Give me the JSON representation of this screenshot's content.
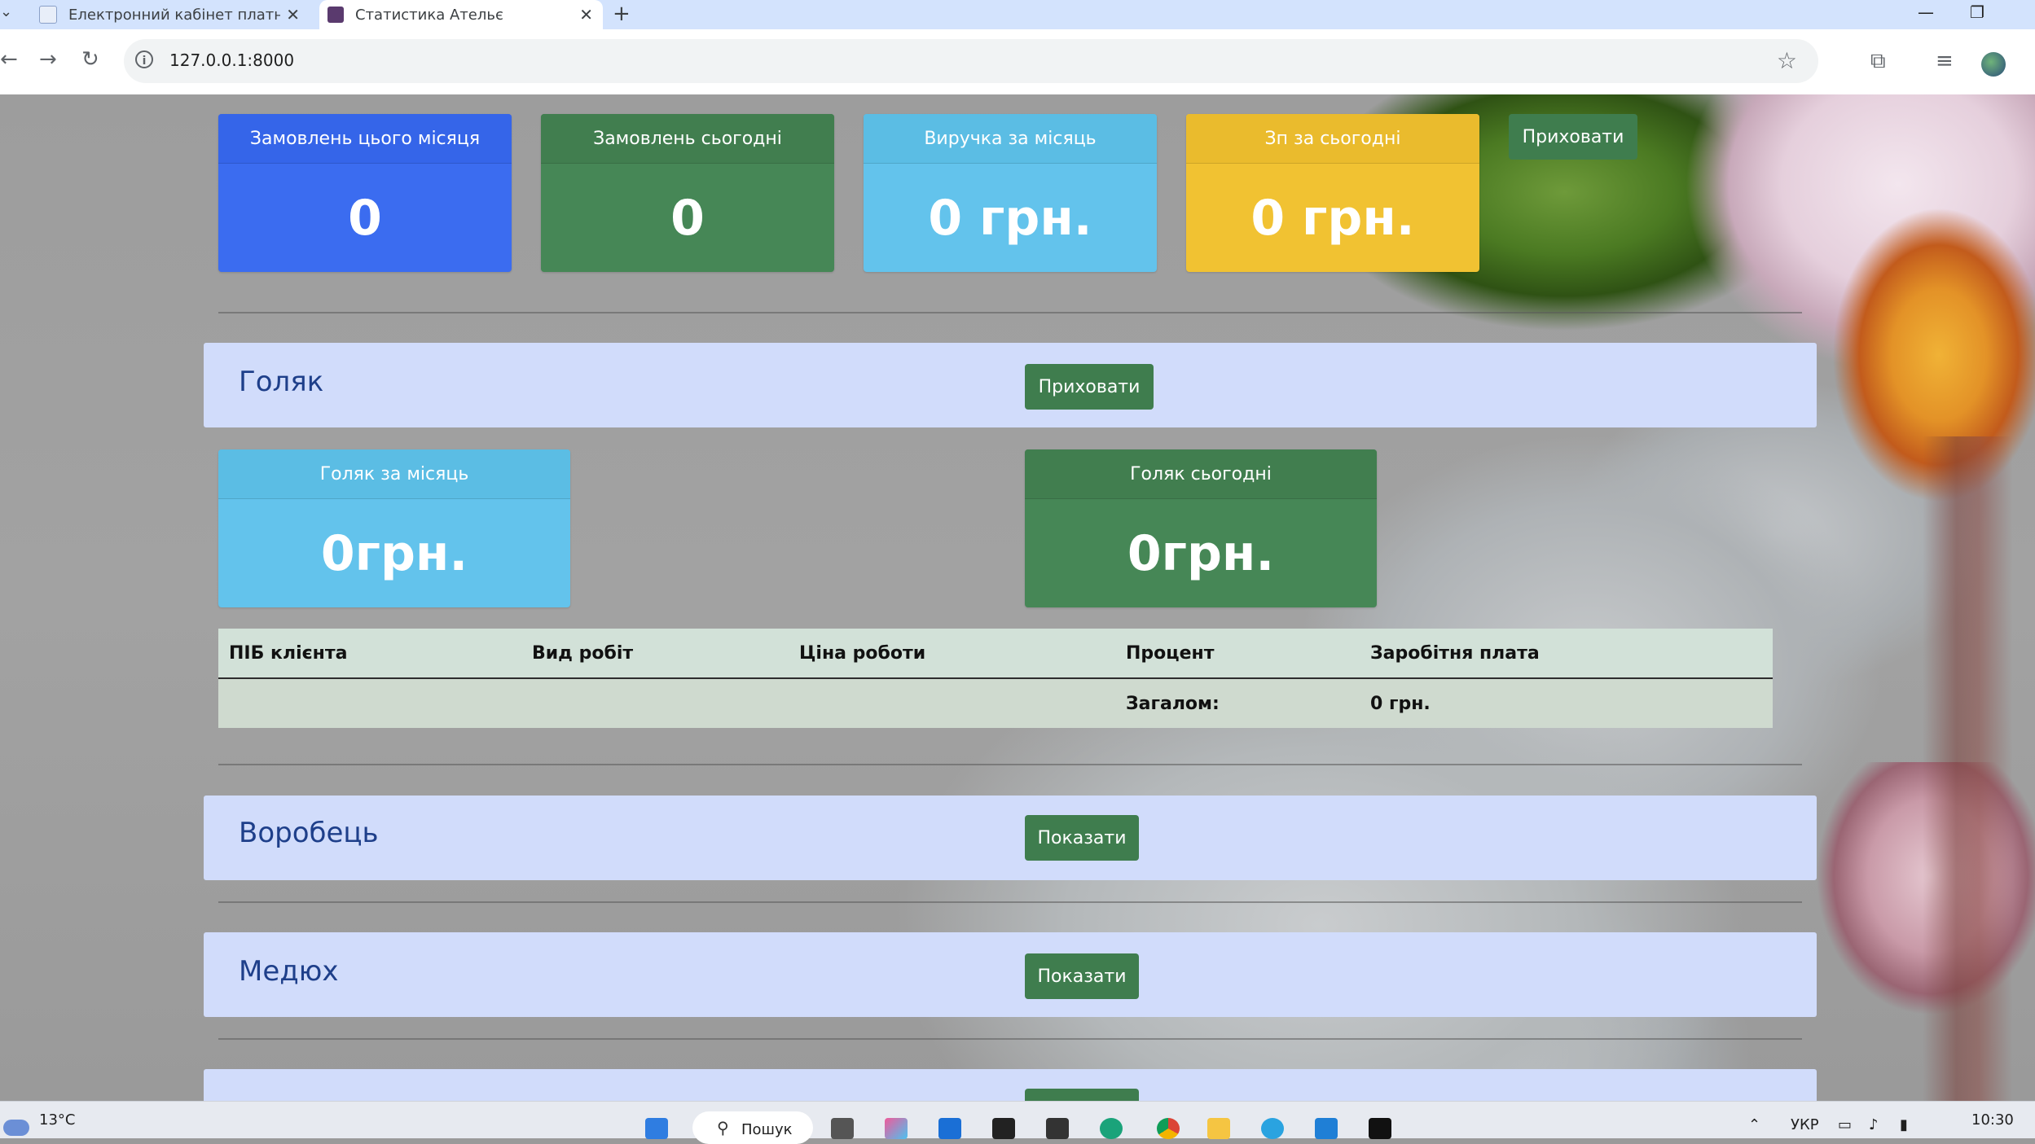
{
  "browser": {
    "tabs": [
      {
        "title": "Електронний кабінет платника"
      },
      {
        "title": "Статистика Ательє"
      }
    ],
    "url": "127.0.0.1:8000"
  },
  "summary": {
    "cards": [
      {
        "title": "Замовлень цього місяця",
        "value": "0",
        "color": "#3b6cf0"
      },
      {
        "title": "Замовлень сьогодні",
        "value": "0",
        "color": "#468756"
      },
      {
        "title": "Виручка за місяць",
        "value": "0 грн.",
        "color": "#63c3ec"
      },
      {
        "title": "Зп за сьогодні",
        "value": "0 грн.",
        "color": "#f1c232"
      }
    ],
    "hide_button": "Приховати"
  },
  "workers": [
    {
      "name": "Голяк",
      "button": "Приховати",
      "month_title": "Голяк за місяць",
      "month_value": "0грн.",
      "today_title": "Голяк сьогодні",
      "today_value": "0грн.",
      "table": {
        "headers": [
          "ПІБ клієнта",
          "Вид робіт",
          "Ціна роботи",
          "Процент",
          "Заробітня плата"
        ],
        "total_label": "Загалом:",
        "total_value": "0 грн."
      }
    },
    {
      "name": "Воробець",
      "button": "Показати"
    },
    {
      "name": "Медюх",
      "button": "Показати"
    }
  ],
  "taskbar": {
    "temperature": "13°C",
    "search": "Пошук",
    "language": "УКР",
    "time": "10:30"
  },
  "colors": {
    "panel": "#d1dcfb",
    "button": "#3f7d4e",
    "name_text": "#1e3f8a"
  }
}
